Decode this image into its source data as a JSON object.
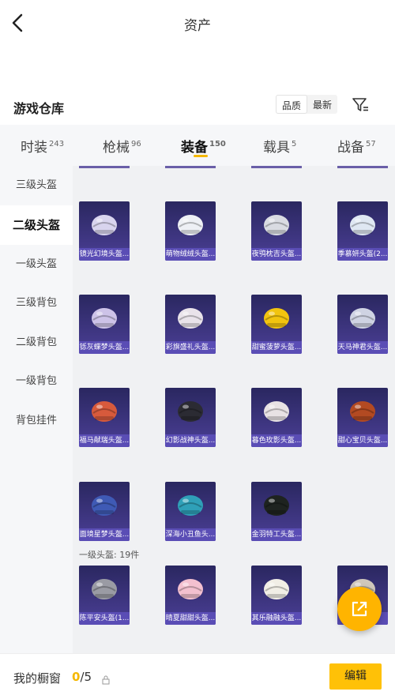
{
  "header": {
    "title": "资产"
  },
  "warehouse": {
    "title": "游戏仓库",
    "sort_options": [
      "品质",
      "最新"
    ],
    "active_sort": "品质"
  },
  "tabs": [
    {
      "label": "时装",
      "count": "243"
    },
    {
      "label": "枪械",
      "count": "96"
    },
    {
      "label": "装备",
      "count": "150"
    },
    {
      "label": "载具",
      "count": "5"
    },
    {
      "label": "战备",
      "count": "57"
    }
  ],
  "active_tab": "装备",
  "sidebar": {
    "items": [
      "三级头盔",
      "二级头盔",
      "一级头盔",
      "三级背包",
      "二级背包",
      "一级背包",
      "背包挂件"
    ],
    "active": "二级头盔"
  },
  "items": [
    {
      "name": "镜光幻境头盔...",
      "color": "#d8d4ee"
    },
    {
      "name": "萌物绒绒头盔...",
      "color": "#eef0f5"
    },
    {
      "name": "夜鸮枕吉头盔...",
      "color": "#d9dbe2"
    },
    {
      "name": "季慕妍头盔(2...",
      "color": "#dfe7f2"
    },
    {
      "name": "铄灰蝶梦头盔...",
      "color": "#cdc3e8"
    },
    {
      "name": "彩旗盛礼头盔...",
      "color": "#e9e3ea"
    },
    {
      "name": "甜蜜菠萝头盔...",
      "color": "#f2c40f"
    },
    {
      "name": "天马神君头盔...",
      "color": "#cfd3e3"
    },
    {
      "name": "福马献瑞头盔...",
      "color": "#d75a3c"
    },
    {
      "name": "幻影战神头盔...",
      "color": "#2b2b33"
    },
    {
      "name": "暮色玫影头盔...",
      "color": "#e8e2e4"
    },
    {
      "name": "甜心宝贝头盔...",
      "color": "#b34a22"
    },
    {
      "name": "面境星梦头盔...",
      "color": "#3f5ab5"
    },
    {
      "name": "深海小丑鱼头...",
      "color": "#2fa0b8"
    },
    {
      "name": "金羽特工头盔...",
      "color": "#1e2320"
    }
  ],
  "section": {
    "caption": "一级头盔: 19件"
  },
  "level1_items": [
    {
      "name": "陈平安头盔(1...",
      "color": "#9a9ba4"
    },
    {
      "name": "晴夏甜甜头盔...",
      "color": "#f3c0cf"
    },
    {
      "name": "其乐融融头盔...",
      "color": "#f1eee6"
    },
    {
      "name": "...)",
      "color": "#cfc7bb"
    }
  ],
  "showcase": {
    "label": "我的橱窗",
    "current": "0",
    "total": "/5"
  },
  "edit_label": "编辑",
  "colors": {
    "accent": "#f5b800",
    "card": "#3b3582",
    "label_bar": "#5a4db5"
  }
}
